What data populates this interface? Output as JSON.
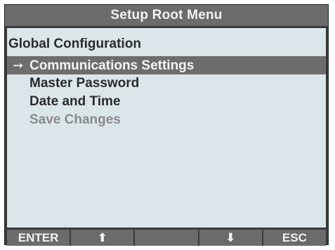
{
  "title": "Setup Root Menu",
  "section_heading": "Global Configuration",
  "menu": {
    "selected_marker": "➙",
    "items": [
      {
        "label": "Communications Settings"
      },
      {
        "label": "Master Password"
      },
      {
        "label": "Date and Time"
      },
      {
        "label": "Save Changes"
      }
    ]
  },
  "softkeys": {
    "k1": "ENTER",
    "k2": "⬆",
    "k3": "",
    "k4": "⬇",
    "k5": "ESC"
  },
  "colors": {
    "frame": "#3a3a3a",
    "bar": "#6b6b6b",
    "screen": "#dbe6ea",
    "text": "#2b2b2b",
    "disabled_text": "#8a8a8a",
    "highlight": "#6d6d6d"
  },
  "icons": {
    "selected_marker": "right-arrow-icon",
    "k2": "up-arrow-icon",
    "k4": "down-arrow-icon"
  }
}
